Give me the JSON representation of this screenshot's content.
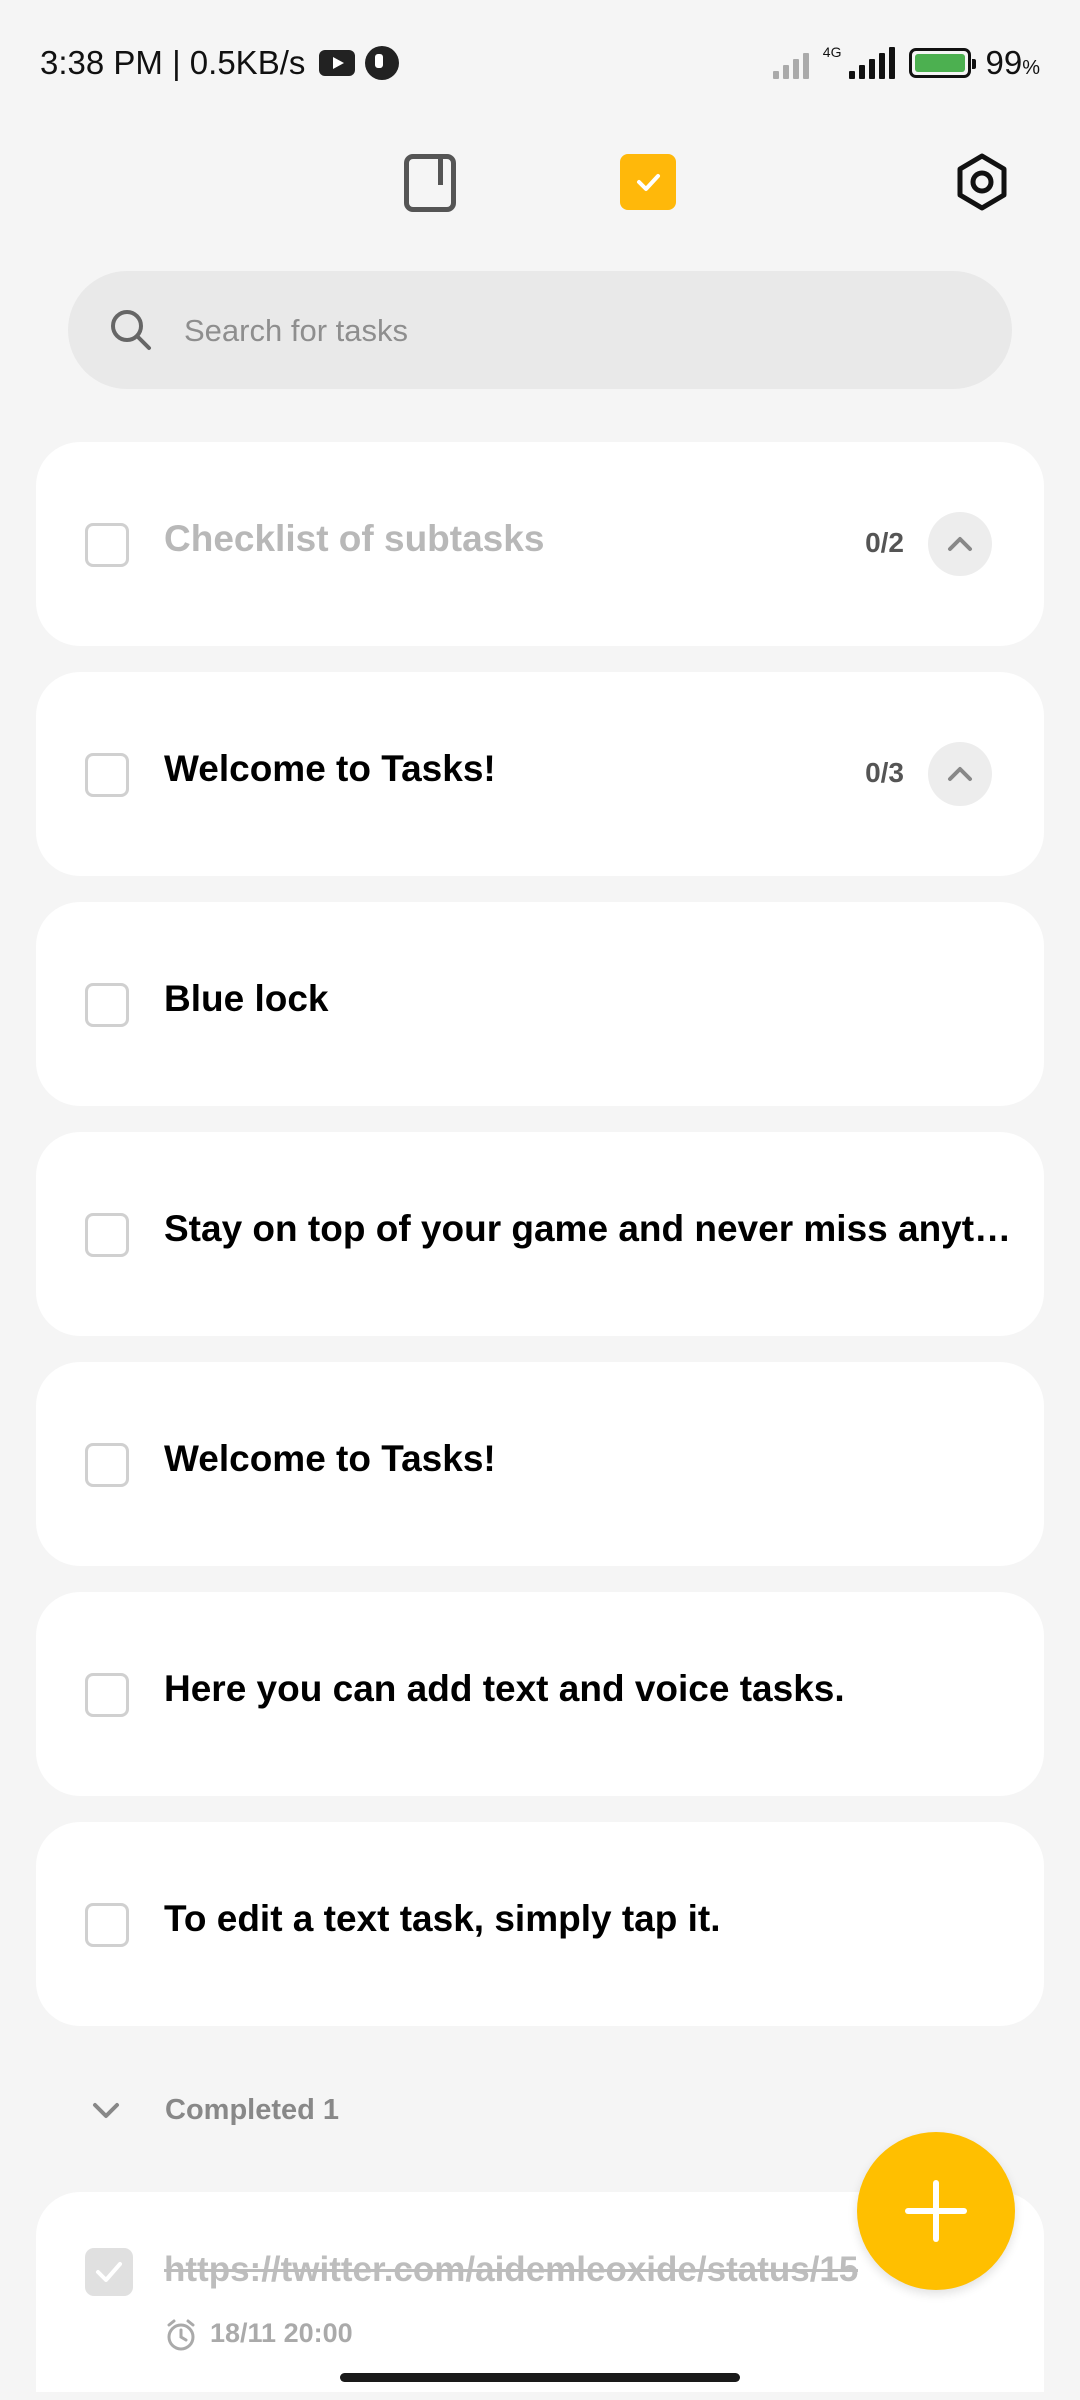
{
  "status_bar": {
    "time_speed": "3:38 PM | 0.5KB/s",
    "network_type": "4G",
    "battery_percent": "99",
    "battery_unit": "%"
  },
  "nav": {
    "notes_tab_icon": "notes-icon",
    "tasks_tab_icon": "tasks-checkbox-icon",
    "settings_icon": "settings-hexagon-icon",
    "accent_color": "#ffb80a"
  },
  "search": {
    "placeholder": "Search for tasks",
    "value": ""
  },
  "tasks": [
    {
      "title": "Checklist of subtasks",
      "subtask_count": "0/2",
      "dimmed": true
    },
    {
      "title": "Welcome to Tasks!",
      "subtask_count": "0/3",
      "dimmed": false
    },
    {
      "title": "Blue lock"
    },
    {
      "title": "Stay on top of your game and never miss anything"
    },
    {
      "title": "Welcome to Tasks!"
    },
    {
      "title": "Here you can add text and voice tasks."
    },
    {
      "title": "To edit a text task, simply tap it."
    }
  ],
  "completed": {
    "label": "Completed 1",
    "items": [
      {
        "title": "https://twitter.com/aidemleoxide/status/15",
        "reminder": "18/11 20:00"
      }
    ]
  },
  "fab": {
    "icon": "plus-icon",
    "color": "#ffbf00"
  }
}
